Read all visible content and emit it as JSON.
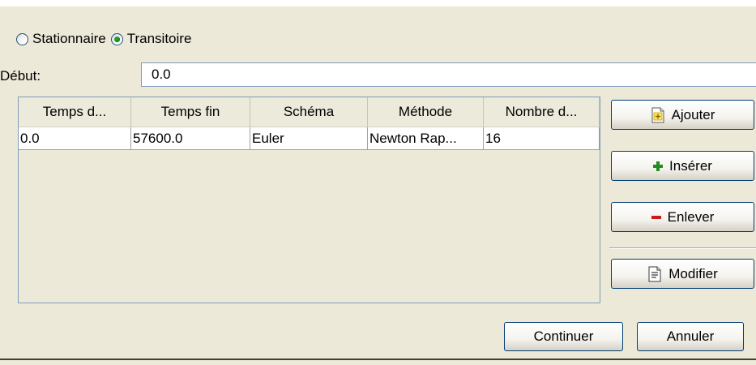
{
  "mode": {
    "options": [
      {
        "label": "Stationnaire",
        "selected": false
      },
      {
        "label": "Transitoire",
        "selected": true
      }
    ]
  },
  "debut": {
    "label": "Début:",
    "value": "0.0"
  },
  "table": {
    "columns": [
      "Temps d...",
      "Temps fin",
      "Schéma",
      "Méthode",
      "Nombre d..."
    ],
    "rows": [
      [
        "0.0",
        "57600.0",
        "Euler",
        "Newton Rap...",
        "16"
      ]
    ]
  },
  "side_buttons": {
    "ajouter": "Ajouter",
    "inserer": "Insérer",
    "enlever": "Enlever",
    "modifier": "Modifier"
  },
  "footer": {
    "continuer": "Continuer",
    "annuler": "Annuler"
  },
  "colors": {
    "window_bg": "#ece9d8",
    "radio_selected": "#21a121",
    "button_border": "#003c74"
  }
}
